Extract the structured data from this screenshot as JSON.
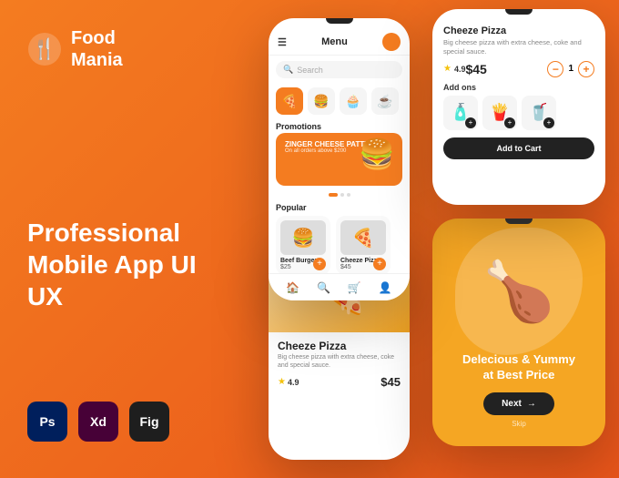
{
  "brand": {
    "name_line1": "Food",
    "name_line2": "Mania",
    "tagline_line1": "Professional",
    "tagline_line2": "Mobile App UI UX"
  },
  "tools": [
    {
      "name": "Ps",
      "label": "Photoshop"
    },
    {
      "name": "Xd",
      "label": "Adobe XD"
    },
    {
      "name": "Fig",
      "label": "Figma"
    }
  ],
  "main_phone": {
    "menu_label": "Menu",
    "search_placeholder": "Search",
    "categories": [
      "🍕",
      "🍔",
      "🧁",
      "☕"
    ],
    "promotions_title": "Promotions",
    "promo_name": "ZINGER CHEESE PATTY",
    "promo_sub": "On all orders above $200",
    "popular_title": "Popular",
    "items": [
      {
        "name": "Beef Burger",
        "price": "$25"
      },
      {
        "name": "Cheeze Pizza",
        "price": "$45"
      }
    ]
  },
  "top_right_phone": {
    "title": "Cheeze Pizza",
    "description": "Big cheese pizza with extra cheese, coke and special sauce.",
    "rating": "4.9",
    "price": "$45",
    "qty": "1",
    "addons_title": "Add ons",
    "addons": [
      "🧴",
      "🍟",
      "🥤"
    ],
    "add_btn": "Add to Cart"
  },
  "bottom_left_phone": {
    "title": "Cheeze Pizza",
    "description": "Big cheese pizza with extra cheese, coke and special sauce.",
    "rating": "4.9",
    "price": "$45"
  },
  "bottom_right_phone": {
    "tagline_line1": "Delecious & Yummy",
    "tagline_line2": "at Best Price",
    "next_btn": "Next",
    "skip_label": "Skip"
  },
  "colors": {
    "brand_orange": "#f47c20",
    "dark": "#222222",
    "star_yellow": "#f4c20d"
  }
}
